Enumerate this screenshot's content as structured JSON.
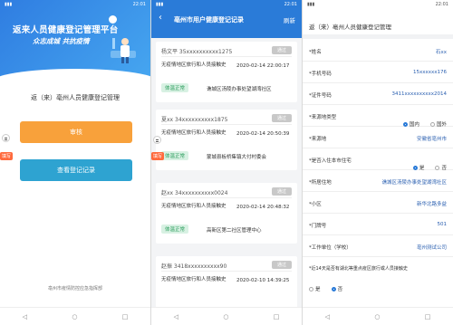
{
  "status_bar": {
    "time": "22:01"
  },
  "screen1": {
    "banner_title": "返来人员健康登记管理平台",
    "banner_sub": "众志成城  共抗疫情",
    "heading": "返（来）亳州人员健康登记管理",
    "review_button": "审核",
    "records_button": "查看登记记录",
    "footer": "亳州市疫情防控应急指挥部",
    "fill_tag": "填写"
  },
  "screen2": {
    "title": "亳州市用户健康登记记录",
    "refresh": "刷新",
    "records": [
      {
        "name": "杨文平  35xxxxxxxxxx1275",
        "badge": "通过",
        "desc": "无疫情地区旅行和人员接触史",
        "date": "2020-02-14 22:00:17",
        "status": "体温正常",
        "addr": "谯城区汤陵办事处望湖湾社区"
      },
      {
        "name": "夏xx  34xxxxxxxxxx1875",
        "badge": "通过",
        "desc": "无疫情地区旅行和人员接触史",
        "date": "2020-02-14 20:50:39",
        "status": "体温正常",
        "addr": "蒙城县板桥集镇大付村委会"
      },
      {
        "name": "赵xx  34xxxxxxxxxx0024",
        "badge": "通过",
        "desc": "无疫情地区旅行和人员接触史",
        "date": "2020-02-14 20:48:32",
        "status": "体温正常",
        "addr": "高新区第二社区管理中心"
      },
      {
        "name": "赵振  3418xxxxxxxxxx90",
        "badge": "通过",
        "desc": "无疫情地区旅行和人员接触史",
        "date": "2020-02-10 14:39:25",
        "status": "体温正常",
        "addr": ""
      }
    ]
  },
  "screen3": {
    "title": "返（来）亳州人员健康登记管理",
    "fields": [
      {
        "label": "*姓名",
        "value": "石xx"
      },
      {
        "label": "*手机号码",
        "value": "15xxxxxx176"
      },
      {
        "label": "*证件号码",
        "value": "3411xxxxxxxxxx2014"
      },
      {
        "label": "*来源地类型",
        "value": ""
      },
      {
        "label": "*来源地",
        "value": "安徽省亳州市"
      },
      {
        "label": "*是否入住本市住宅",
        "value": ""
      },
      {
        "label": "*所居住地",
        "value": "谯城区汤陵办事处望湖湾社区"
      },
      {
        "label": "*小区",
        "value": "新华北路多益"
      },
      {
        "label": "*门牌号",
        "value": "501"
      },
      {
        "label": "*工作单位（学校）",
        "value": "亳州测试公司"
      },
      {
        "label": "*近14天是否有湖北等重点疫区旅行或人员接触史",
        "value": ""
      }
    ],
    "opt_domestic": "国内",
    "opt_abroad": "国外",
    "opt_yes": "是",
    "opt_no": "否"
  }
}
